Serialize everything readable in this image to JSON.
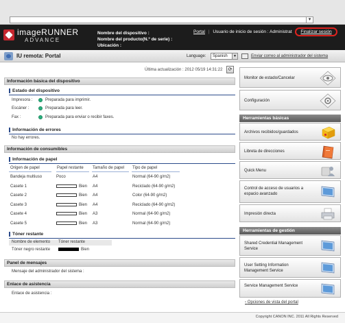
{
  "header": {
    "logo_line1": "imageRUNNER",
    "logo_line2": "ADVANCE",
    "device_name_label": "Nombre del dispositivo :",
    "product_name_label": "Nombre del producto(N.º de serie) :",
    "location_label": "Ubicación :",
    "portal_link": "Portal",
    "login_user_label": "Usuario de inicio de sesión : Administrat",
    "logout_button": "Finalizar sesión"
  },
  "portal_bar": {
    "title": "IU remota: Portal",
    "language_label": "Language:",
    "language_value": "Spanish",
    "mail_link": "Enviar correo al administrador del sistema"
  },
  "main": {
    "last_update": "Última actualización : 2012 05/19 14:31:22",
    "basic_info_title": "Información básica del dispositivo",
    "device_status_title": "Estado del dispositivo",
    "status_rows": [
      {
        "device": "Impresora :",
        "status": "Preparada para imprimir."
      },
      {
        "device": "Escáner :",
        "status": "Preparada para leer."
      },
      {
        "device": "Fax :",
        "status": "Preparada para enviar o recibir faxes."
      }
    ],
    "error_info_title": "Información de errores",
    "error_text": "No hay errores.",
    "consumables_title": "Información de consumibles",
    "paper_info_title": "Información de papel",
    "paper_headers": [
      "Origen de papel",
      "Papel restante",
      "Tamaño de papel",
      "Tipo de papel"
    ],
    "paper_rows": [
      {
        "source": "Bandeja multiuso",
        "remaining": "Poco",
        "bar": false,
        "size": "A4",
        "type": "Normal (64-90 g/m2)"
      },
      {
        "source": "Casete 1",
        "remaining": "Bien",
        "bar": true,
        "size": "A4",
        "type": "Reciclado (64-90 g/m2)"
      },
      {
        "source": "Casete 2",
        "remaining": "Bien",
        "bar": true,
        "size": "A4",
        "type": "Color (64-90 g/m2)"
      },
      {
        "source": "Casete 3",
        "remaining": "Bien",
        "bar": true,
        "size": "A4",
        "type": "Reciclado (64-90 g/m2)"
      },
      {
        "source": "Casete 4",
        "remaining": "Bien",
        "bar": true,
        "size": "A3",
        "type": "Normal (64-90 g/m2)"
      },
      {
        "source": "Casete 5",
        "remaining": "Bien",
        "bar": true,
        "size": "A3",
        "type": "Normal (64-90 g/m2)"
      }
    ],
    "toner_title": "Tóner restante",
    "toner_headers": [
      "Nombre de elemento",
      "Tóner restante"
    ],
    "toner_row": {
      "name": "Tóner negro restante",
      "status": "Bien"
    },
    "messages_title": "Panel de mensajes",
    "admin_message_label": "Mensaje del administrador del sistema :",
    "support_title": "Enlace de asistencia",
    "support_label": "Enlace de asistencia :"
  },
  "sidebar": {
    "top_buttons": [
      "Monitor de estado/Cancelar",
      "Configuración"
    ],
    "basic_tools_title": "Herramientas básicas",
    "basic_tools": [
      "Archivos recibidos/guardados",
      "Libreta de direcciones",
      "Quick Menu",
      "Control de acceso de usuarios a espacio avanzado",
      "Impresión directa"
    ],
    "management_title": "Herramientas de gestión",
    "management_tools": [
      "Shared Credential Management Service",
      "User Setting Information Management Service",
      "Service Management Service"
    ],
    "portal_options_link": "Opciones de vista del portal"
  },
  "footer": {
    "copyright": "Copyright CANON INC. 2011 All Rights Reserved"
  },
  "colors": {
    "header_bg": "#1c1c1c",
    "logo_red": "#c6262e",
    "status_green": "#2ab07f",
    "logout_highlight": "#e0231f",
    "section_blue": "#2a4a8a"
  }
}
